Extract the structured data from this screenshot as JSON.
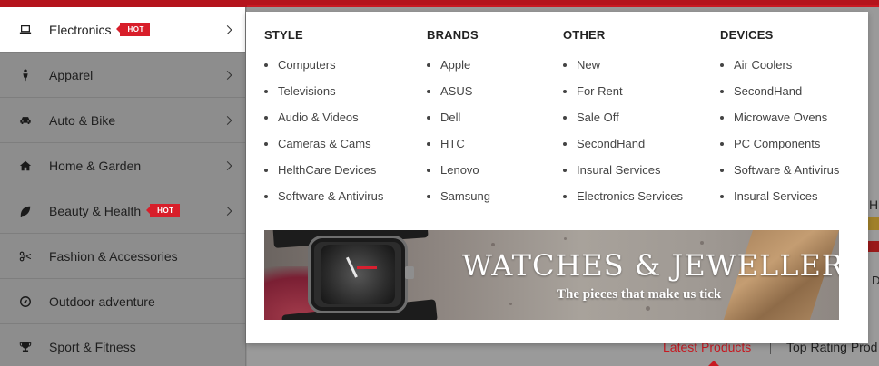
{
  "sidebar": {
    "items": [
      {
        "label": "Electronics",
        "icon": "laptop-icon",
        "hot": "HOT",
        "has_arrow": true,
        "active": true
      },
      {
        "label": "Apparel",
        "icon": "person-icon",
        "hot": "",
        "has_arrow": true,
        "active": false
      },
      {
        "label": "Auto & Bike",
        "icon": "car-icon",
        "hot": "",
        "has_arrow": true,
        "active": false
      },
      {
        "label": "Home & Garden",
        "icon": "home-icon",
        "hot": "",
        "has_arrow": true,
        "active": false
      },
      {
        "label": "Beauty & Health",
        "icon": "leaf-icon",
        "hot": "HOT",
        "has_arrow": true,
        "active": false
      },
      {
        "label": "Fashion & Accessories",
        "icon": "scissors-icon",
        "hot": "",
        "has_arrow": false,
        "active": false
      },
      {
        "label": "Outdoor adventure",
        "icon": "compass-icon",
        "hot": "",
        "has_arrow": false,
        "active": false
      },
      {
        "label": "Sport & Fitness",
        "icon": "trophy-icon",
        "hot": "",
        "has_arrow": false,
        "active": false
      }
    ]
  },
  "mega_menu": {
    "columns": [
      {
        "title": "STYLE",
        "links": [
          "Computers",
          "Televisions",
          "Audio & Videos",
          "Cameras & Cams",
          "HelthCare Devices",
          "Software & Antivirus"
        ]
      },
      {
        "title": "BRANDS",
        "links": [
          "Apple",
          "ASUS",
          "Dell",
          "HTC",
          "Lenovo",
          "Samsung"
        ]
      },
      {
        "title": "OTHER",
        "links": [
          "New",
          "For Rent",
          "Sale Off",
          "SecondHand",
          "Insural Services",
          "Electronics Services"
        ]
      },
      {
        "title": "DEVICES",
        "links": [
          "Air Coolers",
          "SecondHand",
          "Microwave Ovens",
          "PC Components",
          "Software & Antivirus",
          "Insural Services"
        ]
      }
    ],
    "banner": {
      "title": "WATCHES & JEWELLERY",
      "subtitle": "The pieces that make us tick"
    }
  },
  "background": {
    "tab_latest": "Latest Products",
    "tab_top": "Top Rating Prod",
    "right_letter": "H",
    "right_letter2": "D"
  },
  "colors": {
    "accent": "#c81a22",
    "hot_badge": "#d81e2a"
  }
}
